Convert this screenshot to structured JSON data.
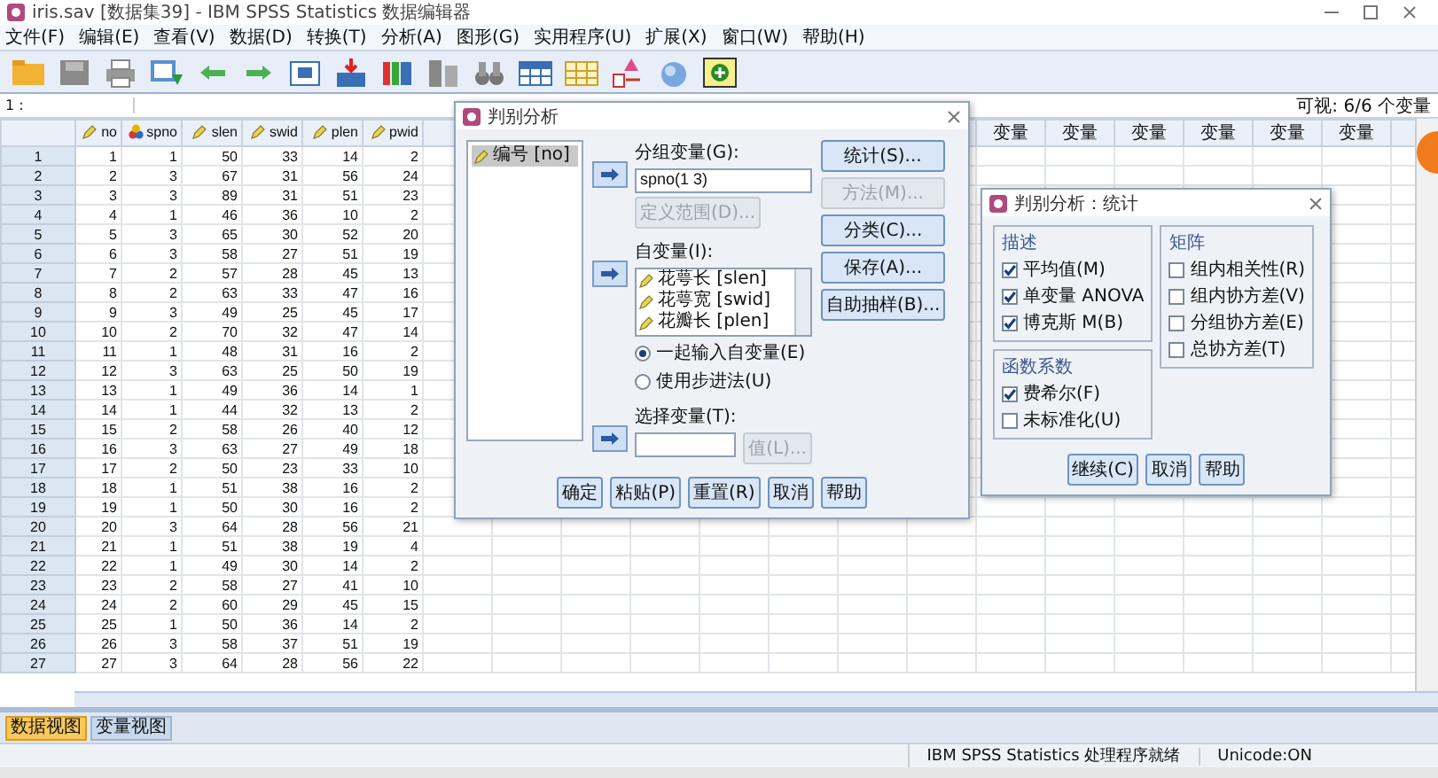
{
  "window": {
    "title": "iris.sav [数据集39] - IBM SPSS Statistics 数据编辑器"
  },
  "menu": [
    "文件(F)",
    "编辑(E)",
    "查看(V)",
    "数据(D)",
    "转换(T)",
    "分析(A)",
    "图形(G)",
    "实用程序(U)",
    "扩展(X)",
    "窗口(W)",
    "帮助(H)"
  ],
  "cell_editor": {
    "reference": "1 :"
  },
  "visible_variables": "可视: 6/6 个变量",
  "table": {
    "columns": [
      {
        "name": "no",
        "kind": "scale"
      },
      {
        "name": "spno",
        "kind": "nominal"
      },
      {
        "name": "slen",
        "kind": "scale"
      },
      {
        "name": "swid",
        "kind": "scale"
      },
      {
        "name": "plen",
        "kind": "scale"
      },
      {
        "name": "pwid",
        "kind": "scale"
      }
    ],
    "empty_columns": [
      "变量",
      "变量",
      "变量",
      "变量",
      "变量",
      "变量"
    ],
    "rows": [
      {
        "number": "1",
        "cells": [
          "1",
          "1",
          "50",
          "33",
          "14",
          "2"
        ]
      },
      {
        "number": "2",
        "cells": [
          "2",
          "3",
          "67",
          "31",
          "56",
          "24"
        ]
      },
      {
        "number": "3",
        "cells": [
          "3",
          "3",
          "89",
          "31",
          "51",
          "23"
        ]
      },
      {
        "number": "4",
        "cells": [
          "4",
          "1",
          "46",
          "36",
          "10",
          "2"
        ]
      },
      {
        "number": "5",
        "cells": [
          "5",
          "3",
          "65",
          "30",
          "52",
          "20"
        ]
      },
      {
        "number": "6",
        "cells": [
          "6",
          "3",
          "58",
          "27",
          "51",
          "19"
        ]
      },
      {
        "number": "7",
        "cells": [
          "7",
          "2",
          "57",
          "28",
          "45",
          "13"
        ]
      },
      {
        "number": "8",
        "cells": [
          "8",
          "2",
          "63",
          "33",
          "47",
          "16"
        ]
      },
      {
        "number": "9",
        "cells": [
          "9",
          "3",
          "49",
          "25",
          "45",
          "17"
        ]
      },
      {
        "number": "10",
        "cells": [
          "10",
          "2",
          "70",
          "32",
          "47",
          "14"
        ]
      },
      {
        "number": "11",
        "cells": [
          "11",
          "1",
          "48",
          "31",
          "16",
          "2"
        ]
      },
      {
        "number": "12",
        "cells": [
          "12",
          "3",
          "63",
          "25",
          "50",
          "19"
        ]
      },
      {
        "number": "13",
        "cells": [
          "13",
          "1",
          "49",
          "36",
          "14",
          "1"
        ]
      },
      {
        "number": "14",
        "cells": [
          "14",
          "1",
          "44",
          "32",
          "13",
          "2"
        ]
      },
      {
        "number": "15",
        "cells": [
          "15",
          "2",
          "58",
          "26",
          "40",
          "12"
        ]
      },
      {
        "number": "16",
        "cells": [
          "16",
          "3",
          "63",
          "27",
          "49",
          "18"
        ]
      },
      {
        "number": "17",
        "cells": [
          "17",
          "2",
          "50",
          "23",
          "33",
          "10"
        ]
      },
      {
        "number": "18",
        "cells": [
          "18",
          "1",
          "51",
          "38",
          "16",
          "2"
        ]
      },
      {
        "number": "19",
        "cells": [
          "19",
          "1",
          "50",
          "30",
          "16",
          "2"
        ]
      },
      {
        "number": "20",
        "cells": [
          "20",
          "3",
          "64",
          "28",
          "56",
          "21"
        ]
      },
      {
        "number": "21",
        "cells": [
          "21",
          "1",
          "51",
          "38",
          "19",
          "4"
        ]
      },
      {
        "number": "22",
        "cells": [
          "22",
          "1",
          "49",
          "30",
          "14",
          "2"
        ]
      },
      {
        "number": "23",
        "cells": [
          "23",
          "2",
          "58",
          "27",
          "41",
          "10"
        ]
      },
      {
        "number": "24",
        "cells": [
          "24",
          "2",
          "60",
          "29",
          "45",
          "15"
        ]
      },
      {
        "number": "25",
        "cells": [
          "25",
          "1",
          "50",
          "36",
          "14",
          "2"
        ]
      },
      {
        "number": "26",
        "cells": [
          "26",
          "3",
          "58",
          "37",
          "51",
          "19"
        ]
      },
      {
        "number": "27",
        "cells": [
          "27",
          "3",
          "64",
          "28",
          "56",
          "22"
        ]
      }
    ]
  },
  "view_tabs": [
    {
      "label": "数据视图",
      "selected": true
    },
    {
      "label": "变量视图",
      "selected": false
    }
  ],
  "status_bar": {
    "message": "IBM SPSS Statistics 处理程序就绪",
    "encoding": "Unicode:ON"
  },
  "discriminant_dialog": {
    "title": "判别分析",
    "source_list": [
      {
        "label": "编号 [no]",
        "kind": "scale",
        "selected": true
      }
    ],
    "grouping": {
      "label": "分组变量(G):",
      "value": "spno(1 3)",
      "button": {
        "label": "定义范围(D)...",
        "disabled": true
      }
    },
    "independents": {
      "label": "自变量(I):",
      "items": [
        {
          "label": "花萼长 [slen]",
          "kind": "scale"
        },
        {
          "label": "花萼宽 [swid]",
          "kind": "scale"
        },
        {
          "label": "花瓣长 [plen]",
          "kind": "scale"
        }
      ]
    },
    "method": [
      {
        "label": "一起输入自变量(E)",
        "selected": true
      },
      {
        "label": "使用步进法(U)",
        "selected": false
      }
    ],
    "selection": {
      "label": "选择变量(T):",
      "button": {
        "label": "值(L)...",
        "disabled": true
      }
    },
    "side_buttons": [
      {
        "label": "统计(S)...",
        "disabled": false
      },
      {
        "label": "方法(M)...",
        "disabled": true
      },
      {
        "label": "分类(C)...",
        "disabled": false
      },
      {
        "label": "保存(A)...",
        "disabled": false
      },
      {
        "label": "自助抽样(B)...",
        "disabled": false
      }
    ],
    "footer_buttons": [
      "确定",
      "粘贴(P)",
      "重置(R)",
      "取消",
      "帮助"
    ]
  },
  "statistics_dialog": {
    "title": "判别分析：统计",
    "columns": [
      [
        {
          "title": "描述",
          "checks": [
            {
              "label": "平均值(M)",
              "checked": true
            },
            {
              "label": "单变量 ANOVA",
              "checked": true
            },
            {
              "label": "博克斯 M(B)",
              "checked": true
            }
          ]
        },
        {
          "title": "函数系数",
          "checks": [
            {
              "label": "费希尔(F)",
              "checked": true
            },
            {
              "label": "未标准化(U)",
              "checked": false
            }
          ]
        }
      ],
      [
        {
          "title": "矩阵",
          "checks": [
            {
              "label": "组内相关性(R)",
              "checked": false
            },
            {
              "label": "组内协方差(V)",
              "checked": false
            },
            {
              "label": "分组协方差(E)",
              "checked": false
            },
            {
              "label": "总协方差(T)",
              "checked": false
            }
          ]
        }
      ]
    ],
    "buttons": [
      "继续(C)",
      "取消",
      "帮助"
    ]
  }
}
